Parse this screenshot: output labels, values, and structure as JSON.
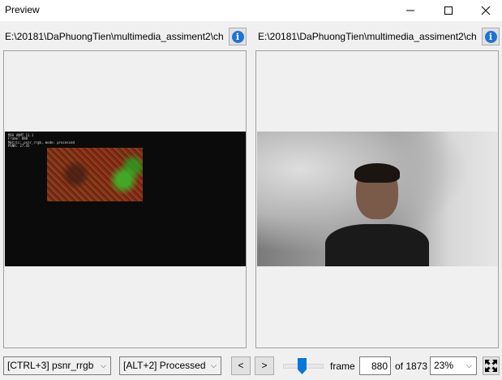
{
  "window": {
    "title": "Preview"
  },
  "left_panel": {
    "path": "E:\\20181\\DaPhuongTien\\multimedia_assiment2\\ch",
    "overlay_lines": [
      "MSU VQMT 11.1",
      "Frame: 880",
      "Metric: psnr_rrgb, mode: processed",
      "PSNR: 27.45"
    ]
  },
  "right_panel": {
    "path": "E:\\20181\\DaPhuongTien\\multimedia_assiment2\\ch"
  },
  "toolbar": {
    "metric_combo": "[CTRL+3] psnr_rrgb",
    "mode_combo": "[ALT+2] Processed",
    "prev_label": "<",
    "next_label": ">",
    "frame_label": "frame",
    "frame_value": "880",
    "of_label": "of 1873",
    "zoom_value": "23%",
    "frame_position": 0.47
  },
  "icons": {
    "info": "info-icon",
    "minimize": "minimize-icon",
    "maximize": "maximize-icon",
    "close": "close-icon",
    "fit": "fullscreen-icon"
  },
  "colors": {
    "accent": "#0078d7",
    "info": "#1e73d6"
  }
}
